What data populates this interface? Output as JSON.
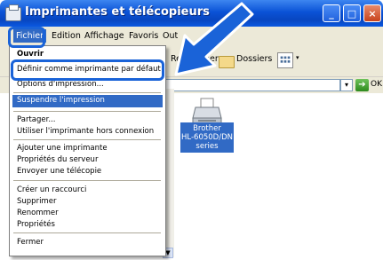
{
  "window": {
    "title": "Imprimantes et télécopieurs"
  },
  "title_buttons": {
    "minimize": "_",
    "maximize": "□",
    "close": "×"
  },
  "menubar": {
    "items": [
      {
        "label": "Fichier"
      },
      {
        "label": "Edition"
      },
      {
        "label": "Affichage"
      },
      {
        "label": "Favoris"
      },
      {
        "label": "Out"
      }
    ]
  },
  "toolbar": {
    "search_label": "Rechercher",
    "folders_label": "Dossiers"
  },
  "addressbar": {
    "go_label": "OK"
  },
  "printer": {
    "label_line1": "Brother",
    "label_line2": "HL-6050D/DN",
    "label_line3": "series"
  },
  "file_menu": {
    "open": "Ouvrir",
    "set_default": "Définir comme imprimante par défaut",
    "print_prefs": "Options d'impression...",
    "pause": "Suspendre l'impression",
    "share": "Partager...",
    "offline": "Utiliser l'imprimante hors connexion",
    "add_printer": "Ajouter une imprimante",
    "server_props": "Propriétés du serveur",
    "send_fax": "Envoyer une télécopie",
    "create_shortcut": "Créer un raccourci",
    "delete": "Supprimer",
    "rename": "Renommer",
    "properties": "Propriétés",
    "close": "Fermer"
  },
  "colors": {
    "accent": "#1a63d8",
    "selection": "#316ac5",
    "titlebar": "#0a52d6"
  }
}
